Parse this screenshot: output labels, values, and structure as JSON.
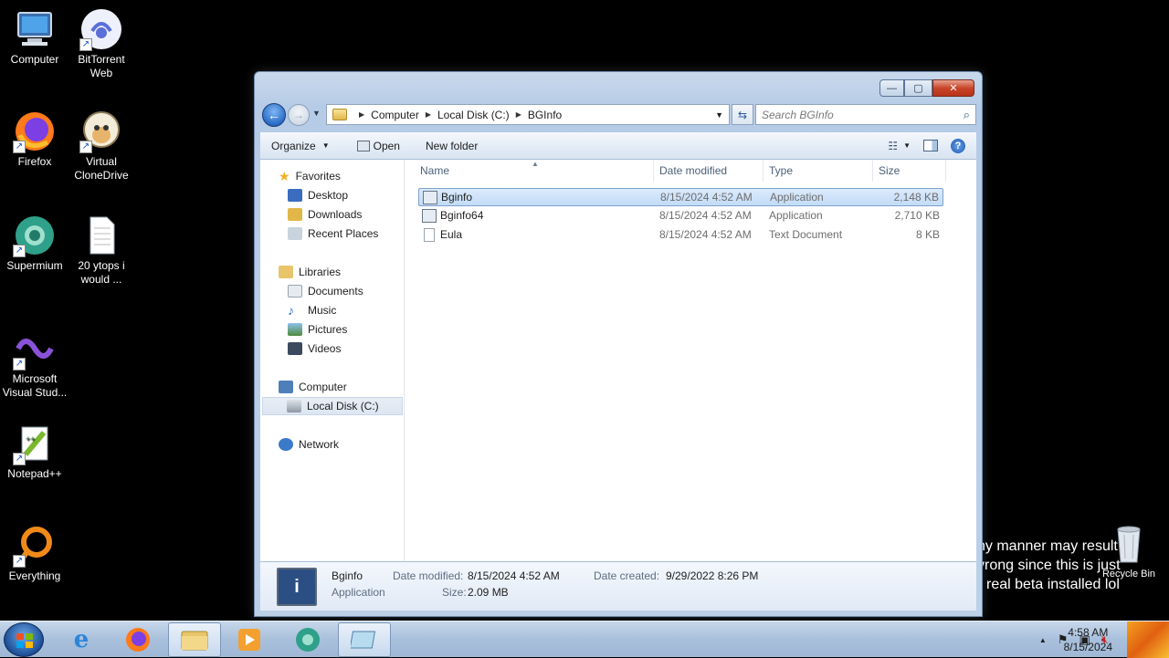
{
  "desktop": {
    "icons": [
      {
        "label": "Computer"
      },
      {
        "label": "BitTorrent Web"
      },
      {
        "label": "Firefox"
      },
      {
        "label": "Virtual CloneDrive"
      },
      {
        "label": "Supermium"
      },
      {
        "label": "20 ytops i would ..."
      },
      {
        "label": "Microsoft Visual Stud..."
      },
      {
        "label": "Notepad++"
      },
      {
        "label": "Everything"
      },
      {
        "label": "Recycle Bin"
      }
    ],
    "overlay_lines": [
      "ny manner may result",
      "vrong since this is just",
      "real beta installed lol"
    ]
  },
  "window": {
    "controls": {
      "minimize": "—",
      "maximize": "▢",
      "close": "✕"
    },
    "breadcrumb": [
      "Computer",
      "Local Disk (C:)",
      "BGInfo"
    ],
    "search_placeholder": "Search BGInfo",
    "toolbar": {
      "organize": "Organize",
      "open": "Open",
      "new_folder": "New folder"
    },
    "nav": {
      "favorites": "Favorites",
      "desktop": "Desktop",
      "downloads": "Downloads",
      "recent_places": "Recent Places",
      "libraries": "Libraries",
      "documents": "Documents",
      "music": "Music",
      "pictures": "Pictures",
      "videos": "Videos",
      "computer": "Computer",
      "local_disk": "Local Disk (C:)",
      "network": "Network"
    },
    "columns": {
      "name": "Name",
      "date": "Date modified",
      "type": "Type",
      "size": "Size"
    },
    "files": [
      {
        "name": "Bginfo",
        "date": "8/15/2024 4:52 AM",
        "type": "Application",
        "size": "2,148 KB"
      },
      {
        "name": "Bginfo64",
        "date": "8/15/2024 4:52 AM",
        "type": "Application",
        "size": "2,710 KB"
      },
      {
        "name": "Eula",
        "date": "8/15/2024 4:52 AM",
        "type": "Text Document",
        "size": "8 KB"
      }
    ],
    "details": {
      "name": "Bginfo",
      "type": "Application",
      "modified_label": "Date modified:",
      "modified_value": "8/15/2024 4:52 AM",
      "created_label": "Date created:",
      "created_value": "9/29/2022 8:26 PM",
      "size_label": "Size:",
      "size_value": "2.09 MB"
    }
  },
  "taskbar": {
    "time": "4:58 AM",
    "date": "8/15/2024"
  }
}
